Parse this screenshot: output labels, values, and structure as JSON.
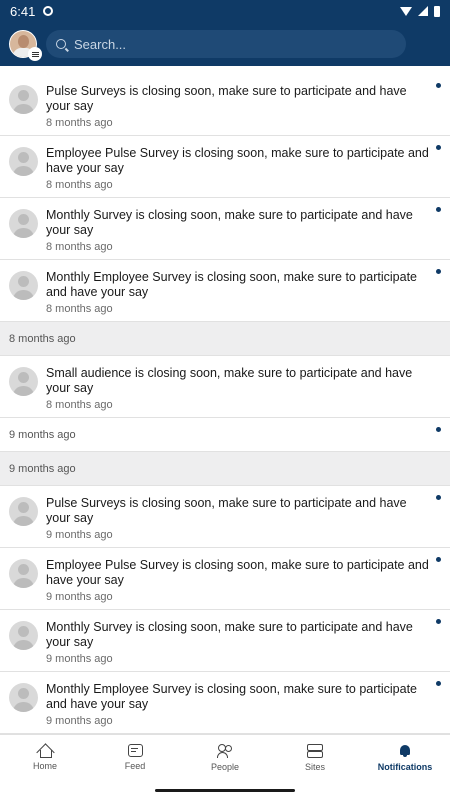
{
  "statusbar": {
    "time": "6:41"
  },
  "search": {
    "placeholder": "Search..."
  },
  "items": [
    {
      "type": "notif",
      "message": "Pulse Surveys is closing soon, make sure to participate and have your say",
      "time": "8 months ago",
      "unread": true
    },
    {
      "type": "notif",
      "message": "Employee Pulse Survey is closing soon, make sure to participate and have your say",
      "time": "8 months ago",
      "unread": true
    },
    {
      "type": "notif",
      "message": "Monthly Survey is closing soon, make sure to participate and have your say",
      "time": "8 months ago",
      "unread": true
    },
    {
      "type": "notif",
      "message": "Monthly Employee Survey is closing soon, make sure to participate and have your say",
      "time": "8 months ago",
      "unread": true
    },
    {
      "type": "separator",
      "label": "8 months ago"
    },
    {
      "type": "notif",
      "message": "Small audience is closing soon, make sure to participate and have your say",
      "time": "8 months ago",
      "unread": false
    },
    {
      "type": "timeonly",
      "label": "9 months ago",
      "unread": true
    },
    {
      "type": "separator",
      "label": "9 months ago"
    },
    {
      "type": "notif",
      "message": "Pulse Surveys is closing soon, make sure to participate and have your say",
      "time": "9 months ago",
      "unread": true
    },
    {
      "type": "notif",
      "message": "Employee Pulse Survey is closing soon, make sure to participate and have your say",
      "time": "9 months ago",
      "unread": true
    },
    {
      "type": "notif",
      "message": "Monthly Survey is closing soon, make sure to participate and have your say",
      "time": "9 months ago",
      "unread": true
    },
    {
      "type": "notif",
      "message": "Monthly Employee Survey is closing soon, make sure to participate and have your say",
      "time": "9 months ago",
      "unread": true
    }
  ],
  "tabs": [
    {
      "label": "Home",
      "icon": "home-icon",
      "active": false
    },
    {
      "label": "Feed",
      "icon": "feed-icon",
      "active": false
    },
    {
      "label": "People",
      "icon": "people-icon",
      "active": false
    },
    {
      "label": "Sites",
      "icon": "sites-icon",
      "active": false
    },
    {
      "label": "Notifications",
      "icon": "bell-icon",
      "active": true
    }
  ],
  "colors": {
    "brand": "#0f3a66",
    "unread_dot": "#0f3a66"
  }
}
